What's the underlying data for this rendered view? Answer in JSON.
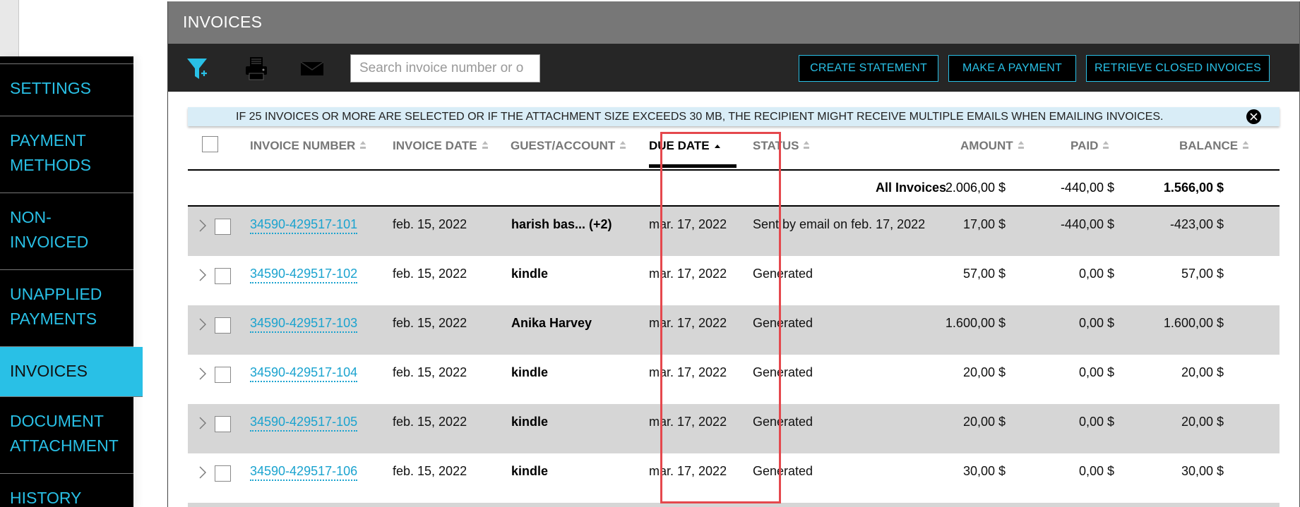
{
  "sidebar": {
    "items": [
      {
        "label_line1": "SETTINGS",
        "label_line2": ""
      },
      {
        "label_line1": "PAYMENT",
        "label_line2": "METHODS"
      },
      {
        "label_line1": "NON-",
        "label_line2": "INVOICED"
      },
      {
        "label_line1": "UNAPPLIED",
        "label_line2": "PAYMENTS"
      },
      {
        "label_line1": "INVOICES",
        "label_line2": ""
      },
      {
        "label_line1": "DOCUMENT",
        "label_line2": "ATTACHMENT"
      },
      {
        "label_line1": "HISTORY",
        "label_line2": ""
      }
    ],
    "active_index": 4
  },
  "panel": {
    "title": "INVOICES"
  },
  "toolbar": {
    "icons": [
      "filter-add-icon",
      "print-icon",
      "email-icon"
    ],
    "search_placeholder": "Search invoice number or o",
    "buttons": {
      "create_statement": "CREATE STATEMENT",
      "make_payment": "MAKE A PAYMENT",
      "retrieve_closed": "RETRIEVE CLOSED INVOICES"
    }
  },
  "banner": {
    "text": "IF 25 INVOICES OR MORE ARE SELECTED OR IF THE ATTACHMENT SIZE EXCEEDS 30 MB, THE RECIPIENT MIGHT RECEIVE MULTIPLE EMAILS WHEN EMAILING INVOICES."
  },
  "table": {
    "columns": {
      "invoice_number": "INVOICE NUMBER",
      "invoice_date": "INVOICE DATE",
      "guest_account": "GUEST/ACCOUNT",
      "due_date": "DUE DATE",
      "status": "STATUS",
      "amount": "AMOUNT",
      "paid": "PAID",
      "balance": "BALANCE"
    },
    "sorted_by": "DUE DATE",
    "sort_direction": "ascending",
    "totals": {
      "label": "All Invoices",
      "amount": "2.006,00 $",
      "paid": "-440,00 $",
      "balance": "1.566,00 $"
    },
    "rows": [
      {
        "invoice_number": "34590-429517-101",
        "invoice_date": "feb. 15, 2022",
        "guest": "harish bas... (+2)",
        "due_date": "mar. 17, 2022",
        "status": "Sent by email on feb. 17, 2022",
        "amount": "17,00 $",
        "paid": "-440,00 $",
        "balance": "-423,00 $"
      },
      {
        "invoice_number": "34590-429517-102",
        "invoice_date": "feb. 15, 2022",
        "guest": "kindle",
        "due_date": "mar. 17, 2022",
        "status": "Generated",
        "amount": "57,00 $",
        "paid": "0,00 $",
        "balance": "57,00 $"
      },
      {
        "invoice_number": "34590-429517-103",
        "invoice_date": "feb. 15, 2022",
        "guest": "Anika Harvey",
        "due_date": "mar. 17, 2022",
        "status": "Generated",
        "amount": "1.600,00 $",
        "paid": "0,00 $",
        "balance": "1.600,00 $"
      },
      {
        "invoice_number": "34590-429517-104",
        "invoice_date": "feb. 15, 2022",
        "guest": "kindle",
        "due_date": "mar. 17, 2022",
        "status": "Generated",
        "amount": "20,00 $",
        "paid": "0,00 $",
        "balance": "20,00 $"
      },
      {
        "invoice_number": "34590-429517-105",
        "invoice_date": "feb. 15, 2022",
        "guest": "kindle",
        "due_date": "mar. 17, 2022",
        "status": "Generated",
        "amount": "20,00 $",
        "paid": "0,00 $",
        "balance": "20,00 $"
      },
      {
        "invoice_number": "34590-429517-106",
        "invoice_date": "feb. 15, 2022",
        "guest": "kindle",
        "due_date": "mar. 17, 2022",
        "status": "Generated",
        "amount": "30,00 $",
        "paid": "0,00 $",
        "balance": "30,00 $"
      }
    ]
  },
  "colors": {
    "accent": "#29c0e6",
    "highlight_box": "#e5484d",
    "row_alt": "#d6d6d6",
    "banner_bg": "#d9edf7"
  }
}
